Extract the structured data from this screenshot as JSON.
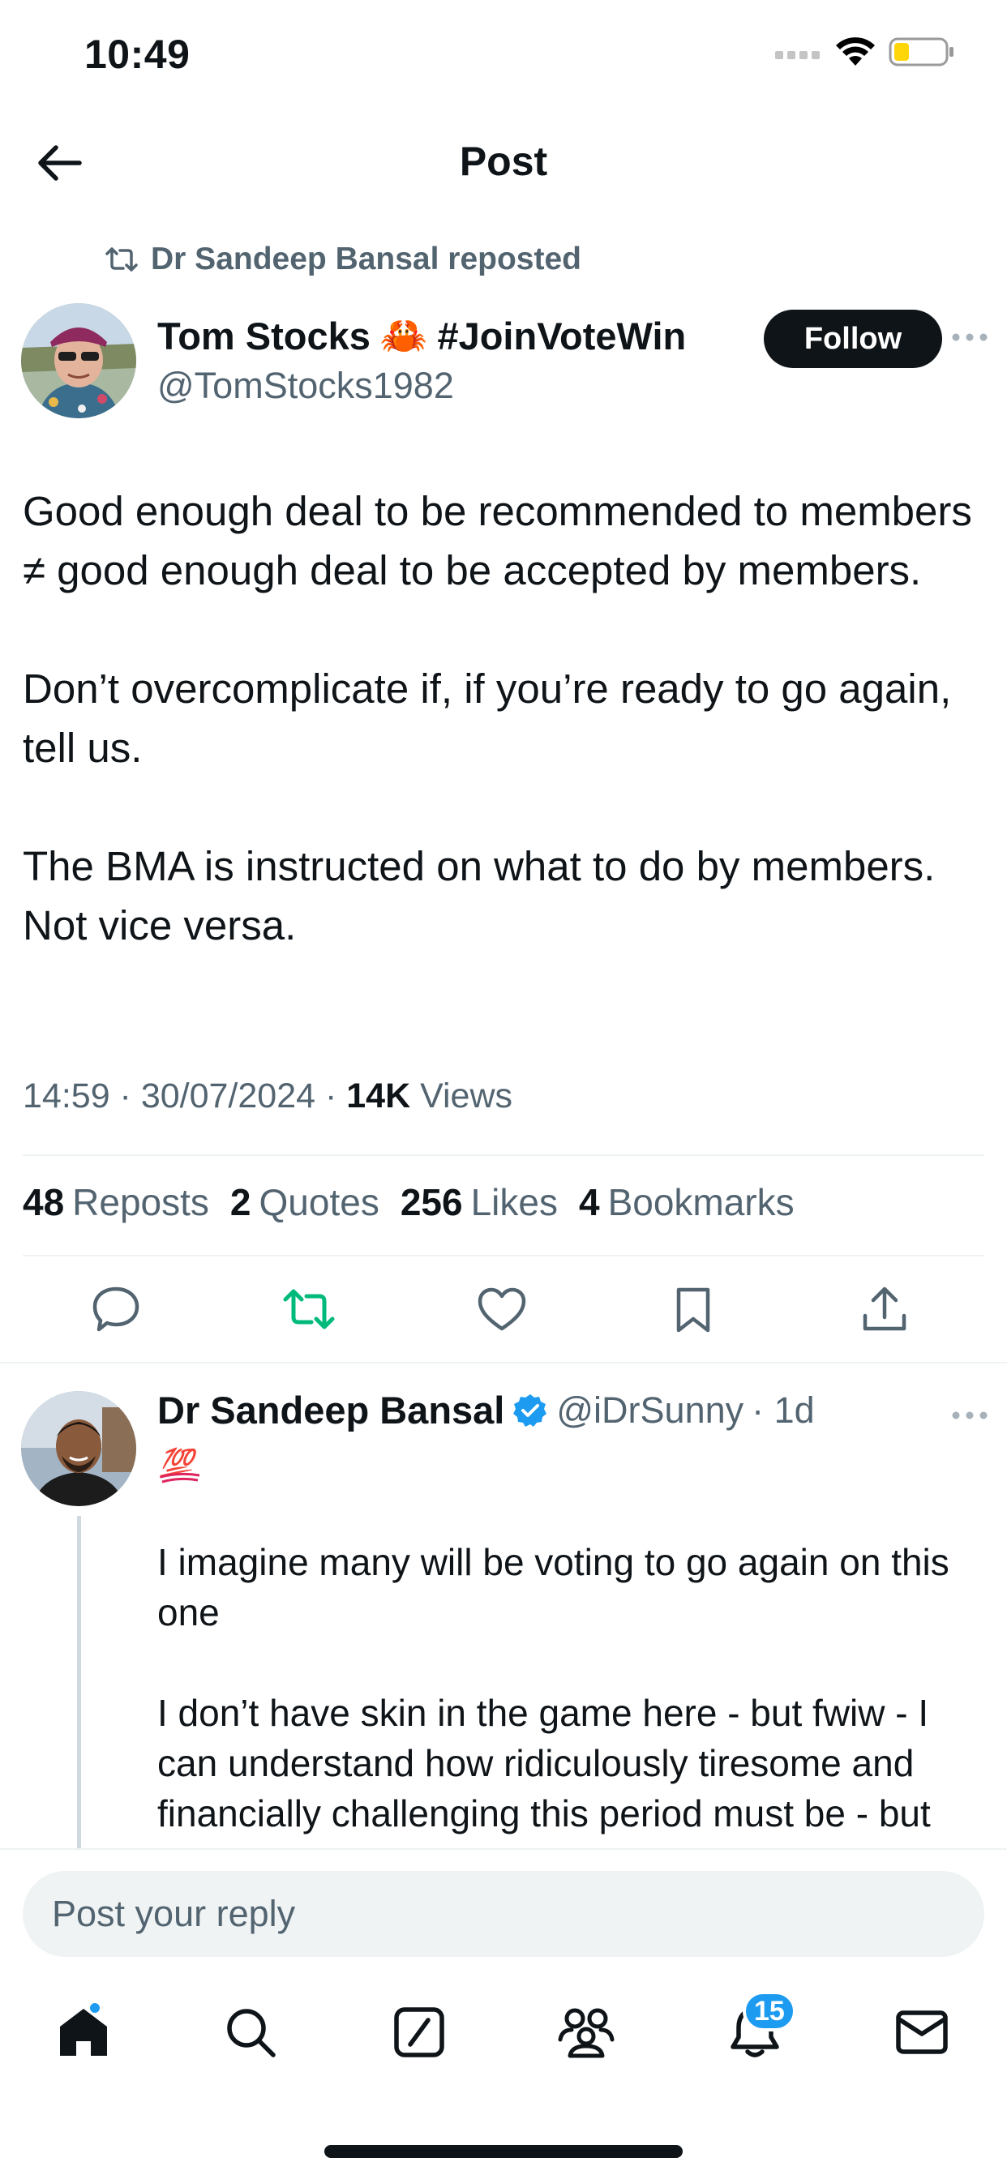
{
  "status_bar": {
    "time": "10:49"
  },
  "header": {
    "title": "Post"
  },
  "repost": {
    "text": "Dr Sandeep Bansal reposted"
  },
  "post": {
    "author_name": "Tom Stocks",
    "author_emoji": "🦀",
    "author_hashtag": "#JoinVoteWin",
    "author_handle": "@TomStocks1982",
    "follow_label": "Follow",
    "paragraphs": [
      "Good enough deal to be recommended to members ≠ good enough deal to be accepted by members.",
      "Don’t overcomplicate if, if you’re ready to go again, tell us.",
      "The BMA is instructed on what to do by members. Not vice versa."
    ],
    "timestamp": "14:59 · 30/07/2024 · ",
    "views_count": "14K",
    "views_label": " Views"
  },
  "stats": {
    "reposts_count": "48",
    "reposts_label": "Reposts",
    "quotes_count": "2",
    "quotes_label": "Quotes",
    "likes_count": "256",
    "likes_label": "Likes",
    "bookmarks_count": "4",
    "bookmarks_label": "Bookmarks"
  },
  "reply": {
    "name": "Dr Sandeep Bansal",
    "handle": "@iDrSunny",
    "time": "· 1d",
    "emoji": "💯",
    "paragraphs": [
      "I imagine many will be voting to go again on this one",
      "I don’t have skin in the game here - but fwiw - I can understand how ridiculously tiresome and financially challenging this period must be - but"
    ]
  },
  "composer": {
    "placeholder": "Post your reply"
  },
  "tabbar": {
    "notifications_badge": "15"
  },
  "colors": {
    "accent": "#1d9bf0",
    "repost_active": "#00ba7c",
    "text": "#0f1419",
    "muted": "#536471",
    "battery": "#ffd60a"
  }
}
